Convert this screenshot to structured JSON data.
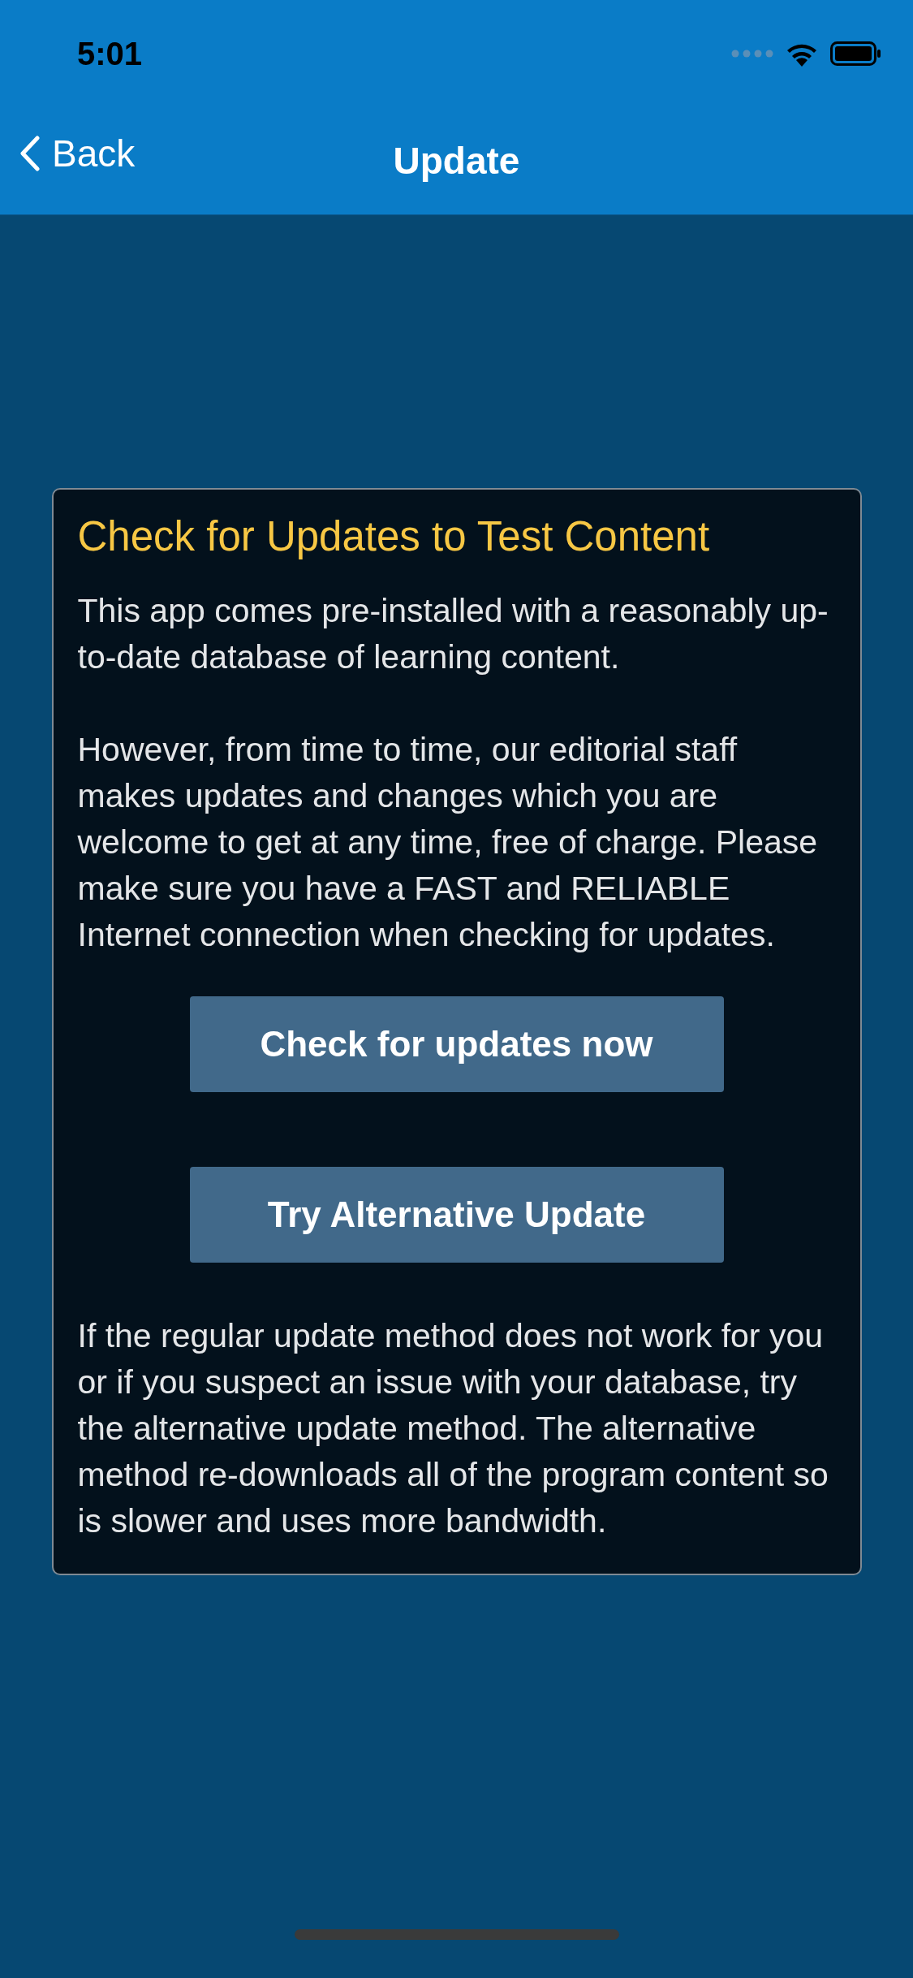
{
  "status_bar": {
    "time": "5:01"
  },
  "nav_bar": {
    "back": "Back",
    "title": "Update"
  },
  "card": {
    "title": "Check for Updates to Test Content",
    "paragraphs": [
      "This app comes pre-installed with a reasonably up-to-date database of learning content.",
      "However, from time to time, our editorial staff makes updates and changes which you are welcome to get at any time, free of charge. Please make sure you have a FAST and RELIABLE Internet connection when checking for updates."
    ],
    "buttons": [
      "Check for updates now",
      "Try Alternative Update"
    ],
    "footnote": "If the regular update method does not work for you or if you suspect an issue with your database, try the alternative update method. The alternative method re-downloads all of the program content so is slower and uses more bandwidth."
  }
}
